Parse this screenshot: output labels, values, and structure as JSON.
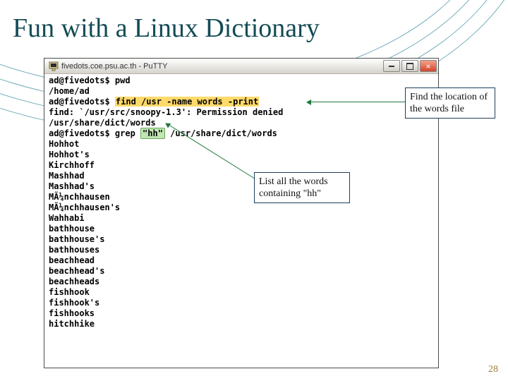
{
  "slide": {
    "title": "Fun with a Linux Dictionary",
    "page_number": "28"
  },
  "putty": {
    "window_title": "fivedots.coe.psu.ac.th - PuTTY"
  },
  "callouts": {
    "find_location": "Find the location of the words file",
    "list_all": "List all the words containing \"hh\""
  },
  "terminal": {
    "prompt1": "ad@fivedots$ ",
    "cmd1": "pwd",
    "out1": "/home/ad",
    "prompt2": "ad@fivedots$ ",
    "cmd2": "find /usr -name words -print",
    "out2": "find: `/usr/src/snoopy-1.3': Permission denied",
    "out3": "/usr/share/dict/words",
    "prompt3": "ad@fivedots$ ",
    "cmd3a": "grep ",
    "cmd3b": "\"hh\"",
    "cmd3c": " /usr/share/dict/words",
    "words": [
      "Hohhot",
      "Hohhot's",
      "Kirchhoff",
      "Mashhad",
      "Mashhad's",
      "MÃ¼nchhausen",
      "MÃ¼nchhausen's",
      "Wahhabi",
      "bathhouse",
      "bathhouse's",
      "bathhouses",
      "beachhead",
      "beachhead's",
      "beachheads",
      "fishhook",
      "fishhook's",
      "fishhooks",
      "hitchhike"
    ]
  }
}
